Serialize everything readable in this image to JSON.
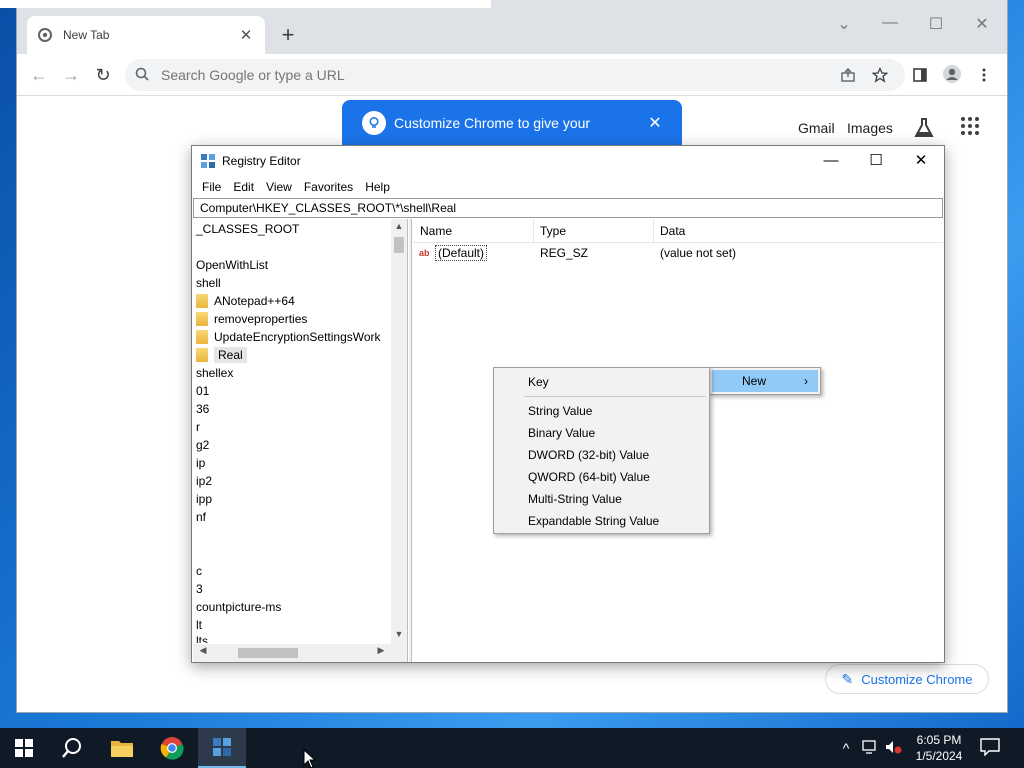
{
  "chrome": {
    "tab_title": "New Tab",
    "tab_close": "✕",
    "new_tab": "+",
    "win_minimize": "⌄",
    "win_min2": "—",
    "win_maximize": "☐",
    "win_close": "✕",
    "back": "←",
    "forward": "→",
    "reload": "↻",
    "omnibox_placeholder": "Search Google or type a URL",
    "promo_text": "Customize Chrome to give your",
    "promo_close": "✕",
    "gmail": "Gmail",
    "images": "Images",
    "customize_chrome": "Customize Chrome",
    "pencil": "✎"
  },
  "regedit": {
    "title": "Registry Editor",
    "minimize": "—",
    "maximize": "☐",
    "close": "✕",
    "menu": [
      "File",
      "Edit",
      "View",
      "Favorites",
      "Help"
    ],
    "address": "Computer\\HKEY_CLASSES_ROOT\\*\\shell\\Real",
    "tree": [
      "_CLASSES_ROOT",
      "OpenWithList",
      "shell",
      "ANotepad++64",
      "removeproperties",
      "UpdateEncryptionSettingsWork",
      "Real",
      "shellex",
      "01",
      "36",
      "r",
      "g2",
      "ip",
      "ip2",
      "ipp",
      "nf",
      "c",
      "3",
      "countpicture-ms",
      "lt",
      "lts"
    ],
    "columns": {
      "name": "Name",
      "type": "Type",
      "data": "Data"
    },
    "rows": [
      {
        "icon": "ab",
        "name": "(Default)",
        "type": "REG_SZ",
        "data": "(value not set)"
      }
    ],
    "scroll_up": "▲",
    "scroll_down": "▼",
    "scroll_left": "◀",
    "scroll_right": "▶"
  },
  "context_menu": {
    "new_label": "New",
    "new_arrow": "›",
    "items": [
      "Key",
      "String Value",
      "Binary Value",
      "DWORD (32-bit) Value",
      "QWORD (64-bit) Value",
      "Multi-String Value",
      "Expandable String Value"
    ]
  },
  "taskbar": {
    "time": "6:05 PM",
    "date": "1/5/2024",
    "tray_chevron": "^"
  },
  "colors": {
    "chrome_blue": "#1a73e8",
    "menu_highlight": "#91c9f7",
    "taskbar": "#101a26"
  }
}
